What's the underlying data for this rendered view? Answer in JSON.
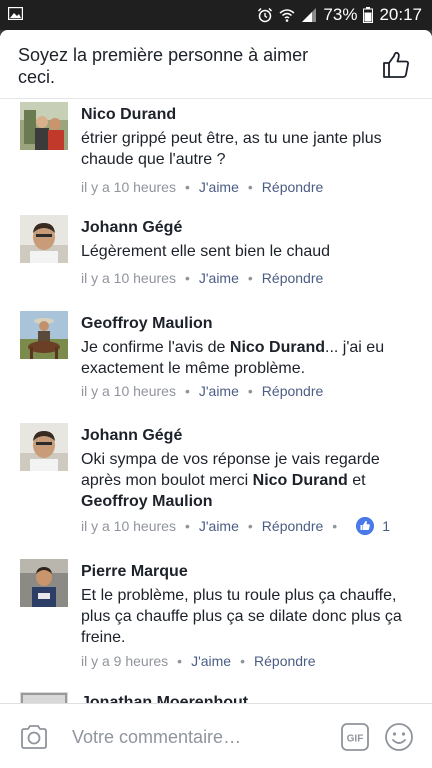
{
  "status_bar": {
    "battery": "73%",
    "time": "20:17",
    "icons": [
      "gallery-icon",
      "alarm-icon",
      "wifi-icon",
      "signal-icon",
      "battery-icon"
    ]
  },
  "likes_header": {
    "text": "Soyez la première personne à aimer ceci.",
    "icon": "thumbs-up-outline-icon"
  },
  "comments": [
    {
      "author": "Nico Durand",
      "text": "étrier grippé peut être, as tu une jante plus chaude que l'autre ?",
      "time": "il y a 10 heures",
      "like_label": "J'aime",
      "reply_label": "Répondre"
    },
    {
      "author": "Johann Gégé",
      "text": "Légèrement elle sent bien le chaud",
      "time": "il y a 10 heures",
      "like_label": "J'aime",
      "reply_label": "Répondre"
    },
    {
      "author": "Geoffroy Maulion",
      "text_parts": [
        "Je confirme l'avis de ",
        "Nico Durand",
        "... j'ai eu exactement le même problème."
      ],
      "time": "il y a 10 heures",
      "like_label": "J'aime",
      "reply_label": "Répondre"
    },
    {
      "author": "Johann Gégé",
      "text_parts": [
        "Oki sympa de vos réponse je vais regarde après mon boulot merci ",
        "Nico Durand",
        " et ",
        "Geoffroy Maulion"
      ],
      "time": "il y a 10 heures",
      "like_label": "J'aime",
      "reply_label": "Répondre",
      "like_count": "1"
    },
    {
      "author": "Pierre Marque",
      "text": "Et le problème,  plus tu roule plus ça chauffe,  plus ça chauffe plus ça se dilate donc plus ça freine.",
      "time": "il y a 9 heures",
      "like_label": "J'aime",
      "reply_label": "Répondre"
    },
    {
      "author": "Jonathan Moerenhout"
    }
  ],
  "composer": {
    "placeholder": "Votre commentaire…",
    "gif_label": "GIF",
    "icons": [
      "camera-icon",
      "gif-icon",
      "emoji-icon"
    ]
  },
  "colors": {
    "text": "#1d2129",
    "meta": "#90949c",
    "action": "#4b5d84",
    "like_blue": "#4a79e8"
  }
}
